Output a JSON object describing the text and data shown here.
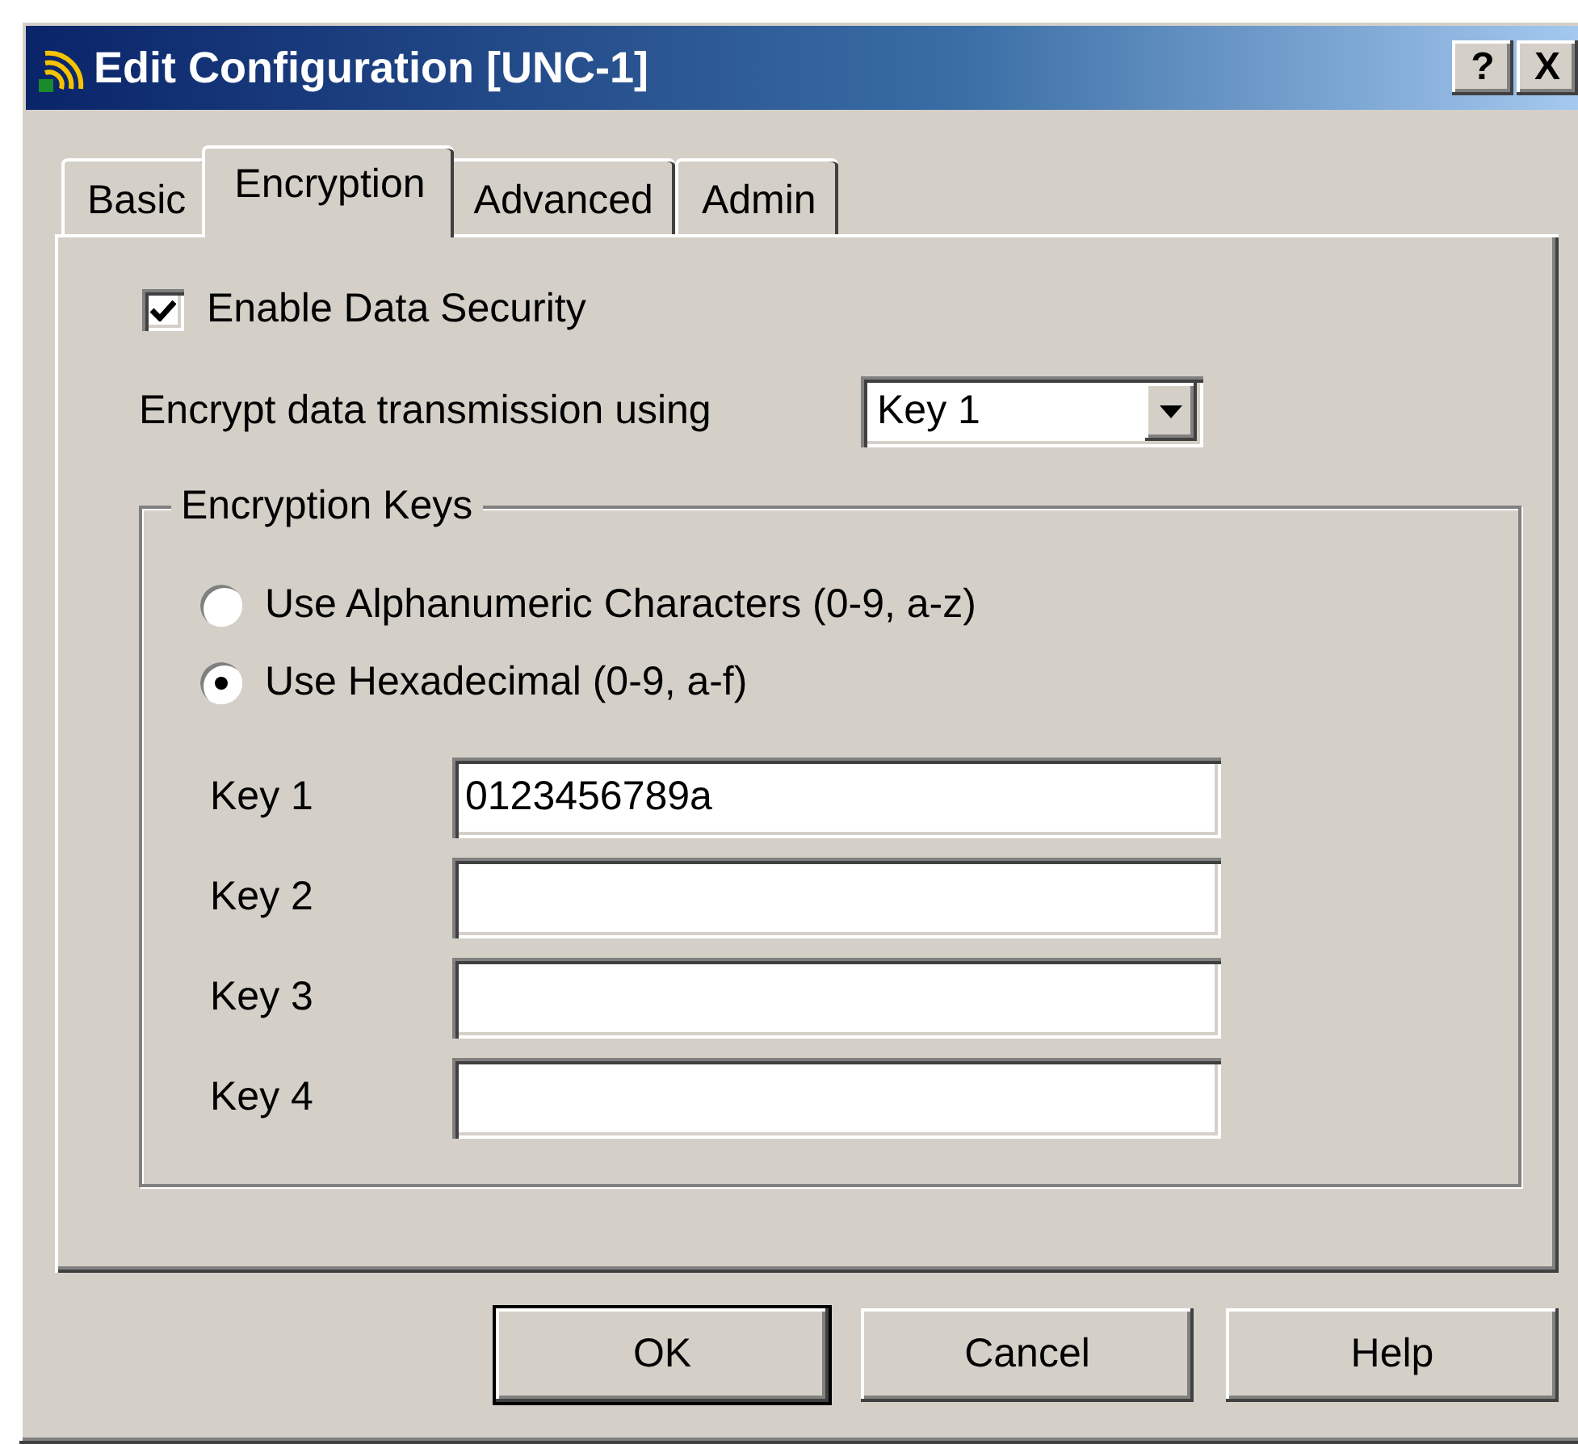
{
  "window": {
    "title": "Edit Configuration [UNC-1]",
    "title_buttons": [
      "?",
      "X"
    ]
  },
  "tabs": [
    {
      "label": "Basic",
      "selected": false
    },
    {
      "label": "Encryption",
      "selected": true
    },
    {
      "label": "Advanced",
      "selected": false
    },
    {
      "label": "Admin",
      "selected": false
    }
  ],
  "enable_data_security": {
    "label": "Enable Data Security",
    "checked": true
  },
  "encrypt_using": {
    "label": "Encrypt data transmission using",
    "value": "Key 1"
  },
  "encryption_keys": {
    "title": "Encryption Keys",
    "options": [
      {
        "label": "Use Alphanumeric Characters (0-9, a-z)",
        "selected": false
      },
      {
        "label": "Use Hexadecimal (0-9, a-f)",
        "selected": true
      }
    ],
    "keys": [
      {
        "label": "Key 1",
        "value": "0123456789a"
      },
      {
        "label": "Key 2"
      },
      {
        "label": "Key 3"
      },
      {
        "label": "Key 4"
      }
    ]
  },
  "buttons": [
    {
      "label": "OK",
      "default": true
    },
    {
      "label": "Cancel",
      "default": false
    },
    {
      "label": "Help",
      "default": false
    }
  ]
}
